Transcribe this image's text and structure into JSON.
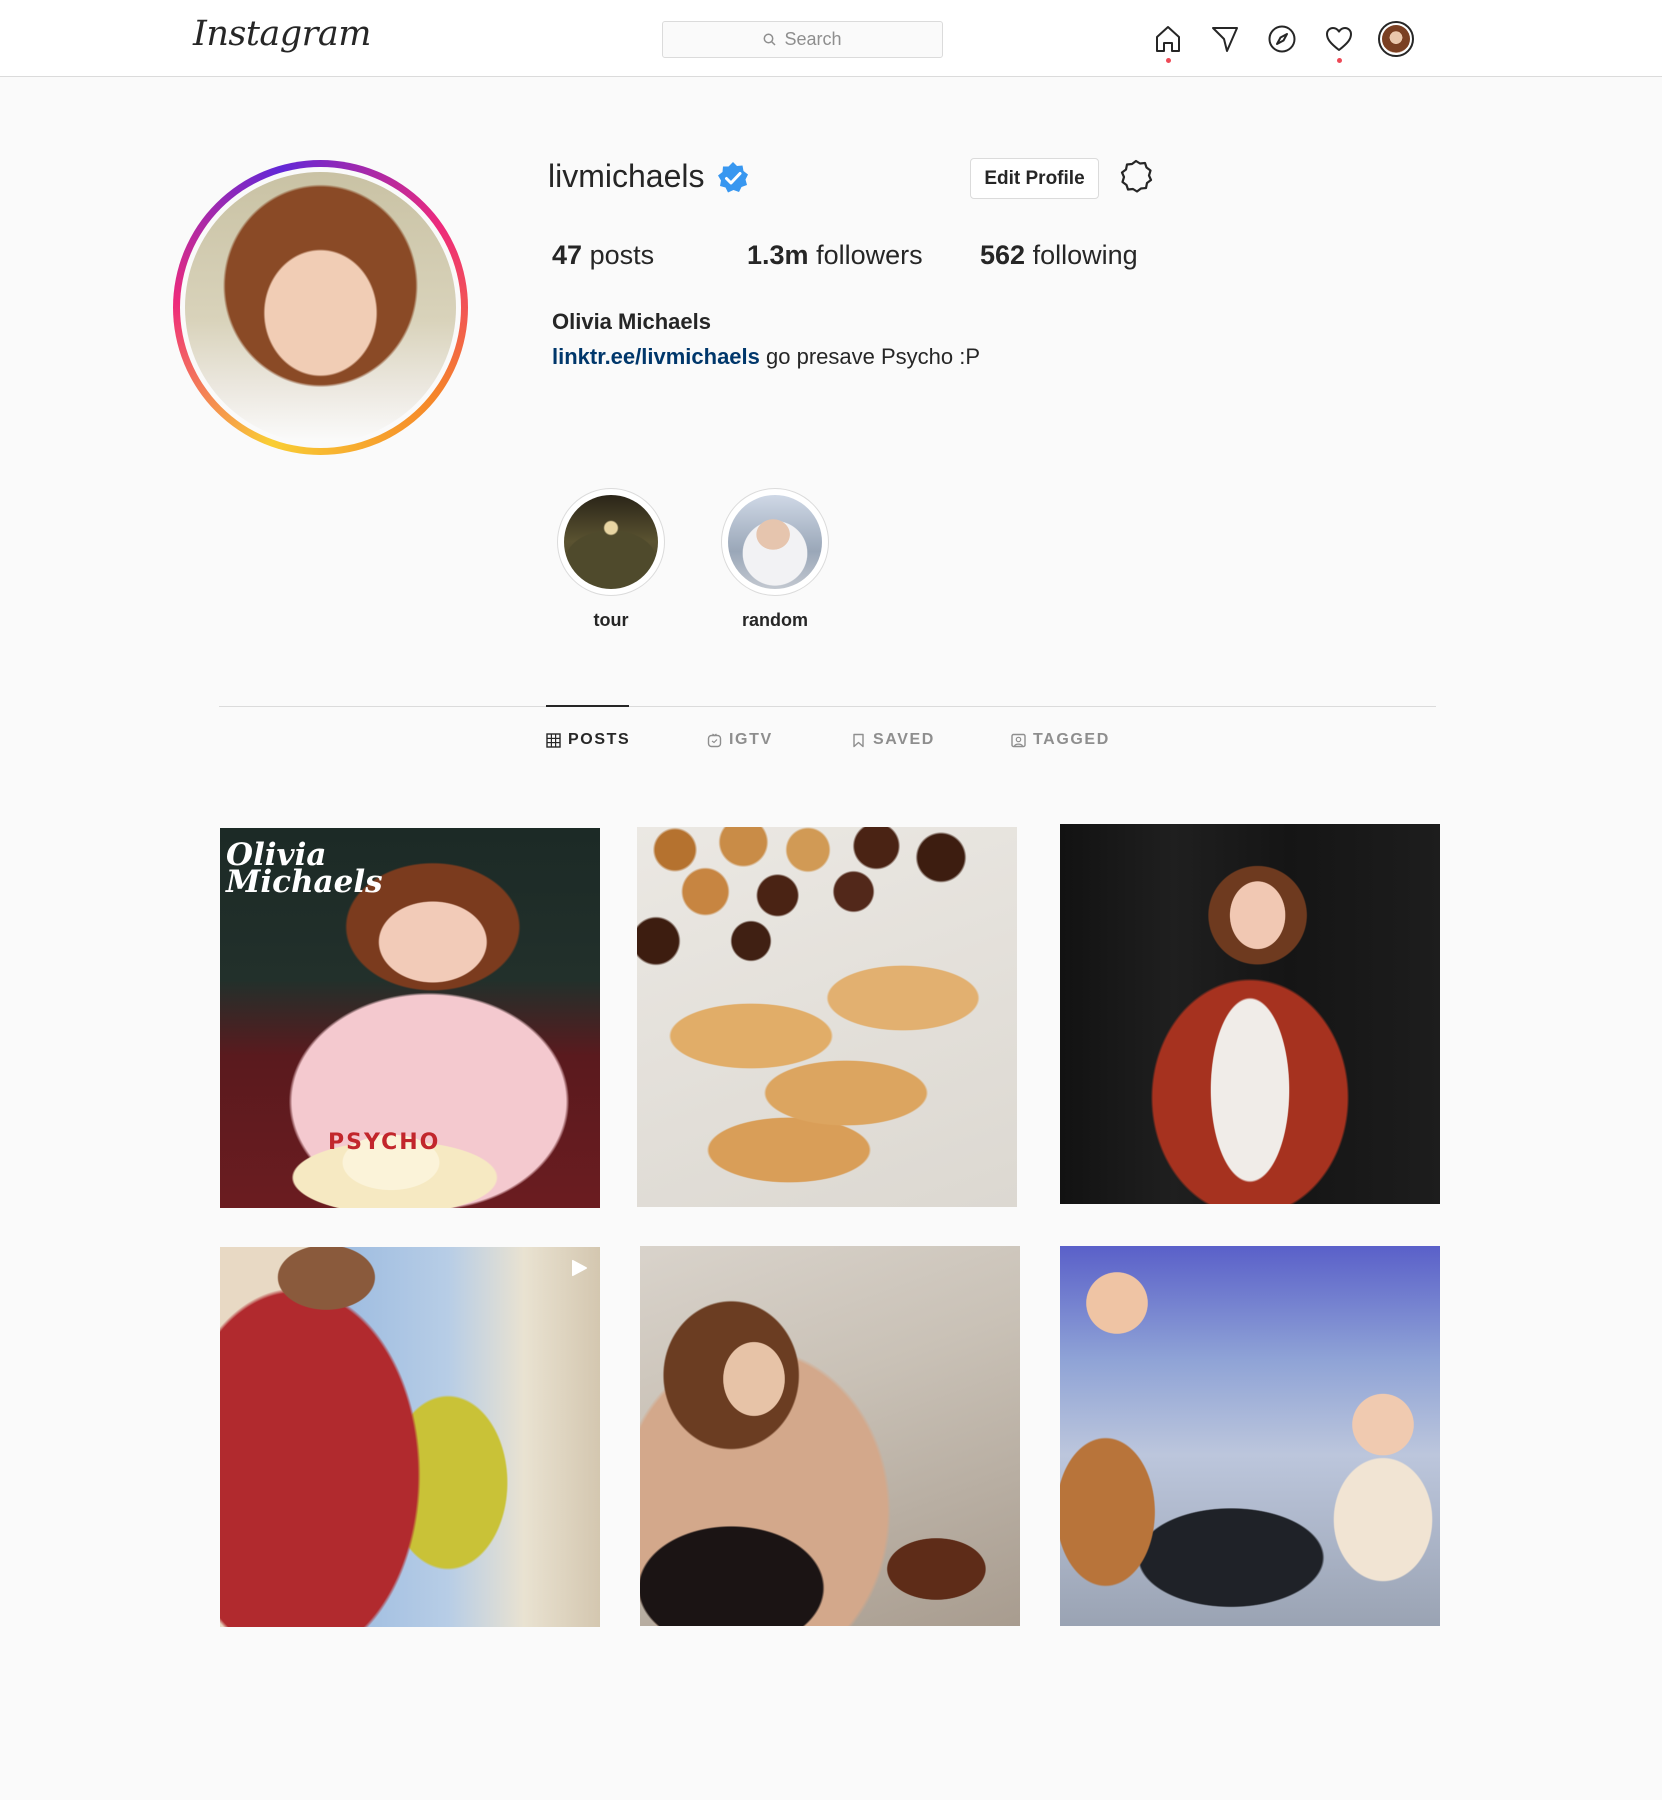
{
  "header": {
    "logo": "Instagram",
    "search_placeholder": "Search",
    "nav_icons": [
      "home-icon",
      "direct-icon",
      "explore-icon",
      "activity-icon",
      "profile-avatar"
    ]
  },
  "profile": {
    "username": "livmichaels",
    "verified": true,
    "edit_button": "Edit Profile",
    "stats": {
      "posts_count": "47",
      "posts_label": "posts",
      "followers_count": "1.3m",
      "followers_label": "followers",
      "following_count": "562",
      "following_label": "following"
    },
    "full_name": "Olivia Michaels",
    "bio_link": "linktr.ee/livmichaels",
    "bio_text": " go presave Psycho :P"
  },
  "highlights": [
    {
      "label": "tour"
    },
    {
      "label": "random"
    }
  ],
  "tabs": [
    {
      "label": "POSTS",
      "active": true
    },
    {
      "label": "IGTV",
      "active": false
    },
    {
      "label": "SAVED",
      "active": false
    },
    {
      "label": "TAGGED",
      "active": false
    }
  ],
  "posts": {
    "post1_title_line1": "Olivia",
    "post1_title_line2": "Michaels",
    "post1_cake_text": "PSYCHO"
  },
  "colors": {
    "accent_link": "#00376b",
    "verified_blue": "#3897f0",
    "notification_dot": "#ed4956",
    "border": "#dbdbdb",
    "background": "#fafafa"
  }
}
